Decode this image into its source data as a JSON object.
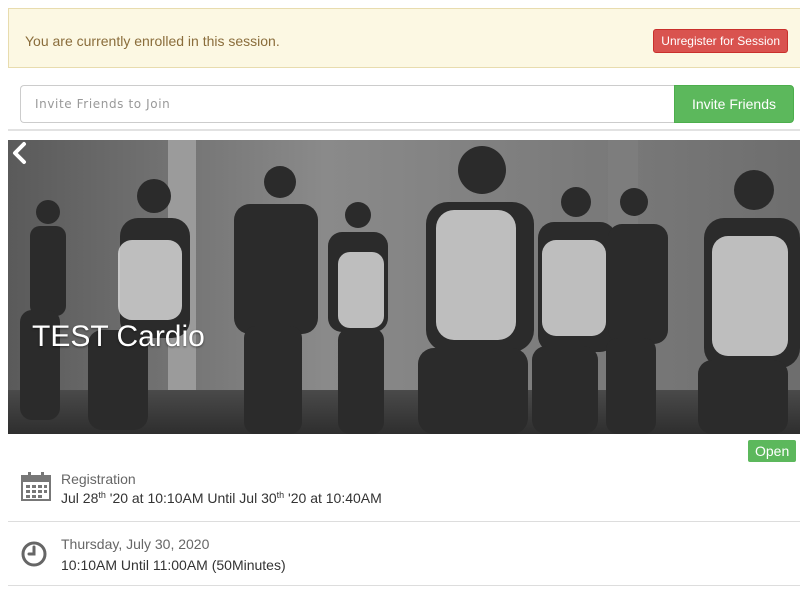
{
  "alert": {
    "message": "You are currently enrolled in this session.",
    "unregister_label": "Unregister for Session"
  },
  "invite": {
    "placeholder": "Invite Friends to Join",
    "button_label": "Invite Friends"
  },
  "session": {
    "title": "TEST Cardio",
    "status": "Open",
    "registration": {
      "label": "Registration",
      "start_month_day": "Jul 28",
      "start_suffix": "th",
      "start_rest": " '20 at 10:10AM Until Jul 30",
      "end_suffix": "th",
      "end_rest": " '20 at 10:40AM"
    },
    "schedule": {
      "date": "Thursday, July 30, 2020",
      "time": "10:10AM Until 11:00AM (50Minutes)"
    }
  },
  "colors": {
    "alert_bg": "#fcf8e3",
    "danger": "#d9534f",
    "success": "#5cb85c"
  },
  "icons": {
    "back": "chevron-left-icon",
    "calendar": "calendar-icon",
    "clock": "clock-icon"
  }
}
